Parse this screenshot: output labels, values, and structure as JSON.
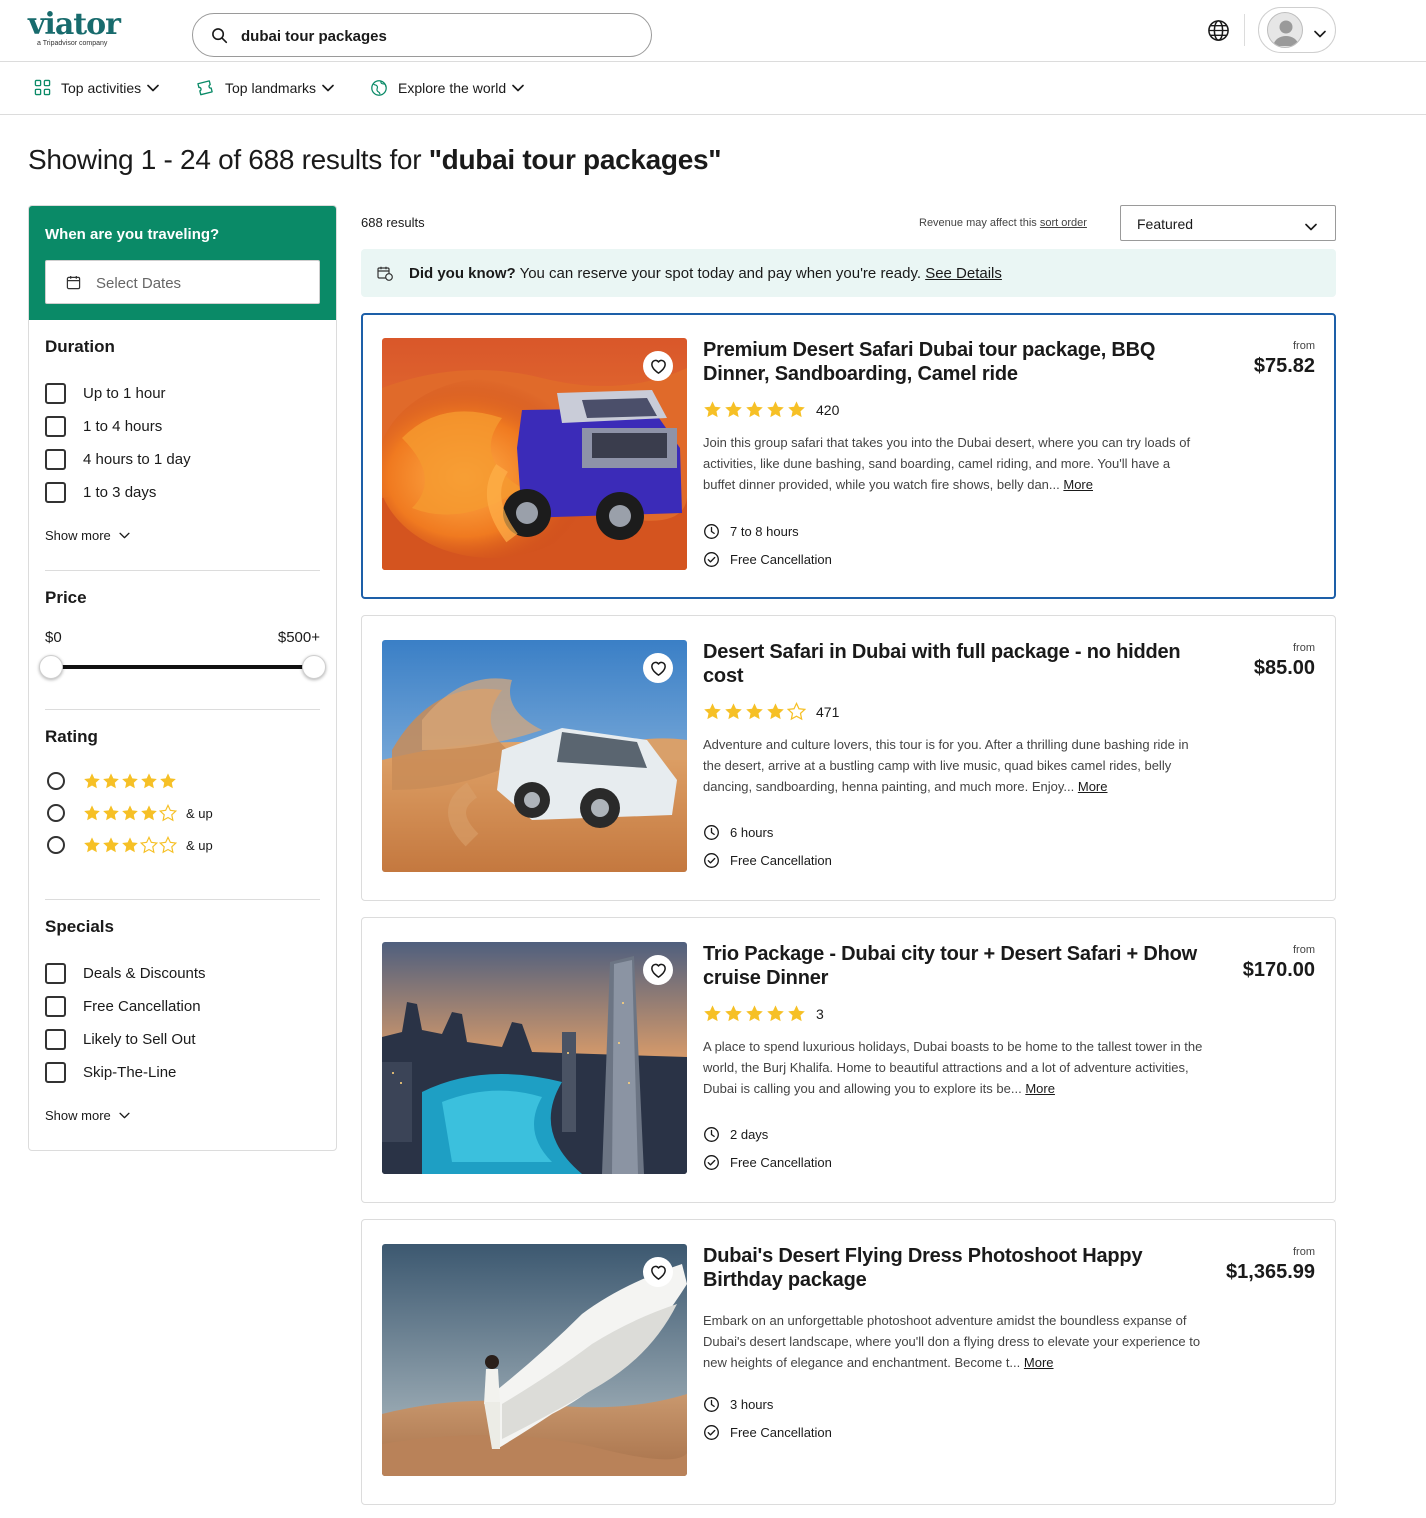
{
  "header": {
    "logo_text": "viator",
    "logo_sub": "a Tripadvisor company",
    "search_value": "dubai tour packages"
  },
  "nav": {
    "items": [
      {
        "label": "Top activities"
      },
      {
        "label": "Top landmarks"
      },
      {
        "label": "Explore the world"
      }
    ]
  },
  "results_title": {
    "prefix": "Showing 1 - 24 of 688 results for ",
    "query": "\"dubai tour packages\""
  },
  "sidebar": {
    "when_title": "When are you traveling?",
    "date_placeholder": "Select Dates",
    "duration": {
      "title": "Duration",
      "options": [
        "Up to 1 hour",
        "1 to 4 hours",
        "4 hours to 1 day",
        "1 to 3 days"
      ],
      "show_more": "Show more"
    },
    "price": {
      "title": "Price",
      "min_label": "$0",
      "max_label": "$500+"
    },
    "rating": {
      "title": "Rating",
      "options": [
        {
          "stars": 5,
          "suffix": ""
        },
        {
          "stars": 4,
          "suffix": "& up"
        },
        {
          "stars": 3,
          "suffix": "& up"
        }
      ]
    },
    "specials": {
      "title": "Specials",
      "options": [
        "Deals & Discounts",
        "Free Cancellation",
        "Likely to Sell Out",
        "Skip-The-Line"
      ],
      "show_more": "Show more"
    }
  },
  "results": {
    "count": "688 results",
    "revenue_note": "Revenue may affect this ",
    "revenue_link": "sort order",
    "sort_value": "Featured",
    "did_you_know": {
      "bold": "Did you know?",
      "text": " You can reserve your spot today and pay when you're ready. ",
      "link": "See Details"
    },
    "more_label": "More",
    "from_label": "from",
    "cards": [
      {
        "title": "Premium Desert Safari Dubai tour package, BBQ Dinner, Sandboarding, Camel ride",
        "rating": 5,
        "reviews": "420",
        "description": "Join this group safari that takes you into the Dubai desert, where you can try loads of activities, like dune bashing, sand boarding, camel riding, and more. You'll have a buffet dinner provided, while you watch fire shows, belly dan...",
        "duration": "7 to 8 hours",
        "cancellation": "Free Cancellation",
        "price": "$75.82"
      },
      {
        "title": "Desert Safari in Dubai with full package - no hidden cost",
        "rating": 4,
        "reviews": "471",
        "description": "Adventure and culture lovers, this tour is for you. After a thrilling dune bashing ride in the desert, arrive at a bustling camp with live music, quad bikes camel rides, belly dancing, sandboarding, henna painting, and much more. Enjoy...",
        "duration": "6 hours",
        "cancellation": "Free Cancellation",
        "price": "$85.00"
      },
      {
        "title": "Trio Package - Dubai city tour + Desert Safari + Dhow cruise Dinner",
        "rating": 5,
        "reviews": "3",
        "description": "A place to spend luxurious holidays, Dubai boasts to be home to the tallest tower in the world, the Burj Khalifa. Home to beautiful attractions and a lot of adventure activities, Dubai is calling you and allowing you to explore its be...",
        "duration": "2 days",
        "cancellation": "Free Cancellation",
        "price": "$170.00"
      },
      {
        "title": "Dubai's Desert Flying Dress Photoshoot Happy Birthday package",
        "description": "Embark on an unforgettable photoshoot adventure amidst the boundless expanse of Dubai's desert landscape, where you'll don a flying dress to elevate your experience to new heights of elegance and enchantment. Become t...",
        "duration": "3 hours",
        "cancellation": "Free Cancellation",
        "price": "$1,365.99"
      }
    ]
  },
  "colors": {
    "brand_green": "#0a8a67",
    "logo_teal": "#186b6d",
    "star_yellow": "#f6c026",
    "selected_border": "#1d5fa8",
    "dyk_bg": "#eaf6f4"
  }
}
